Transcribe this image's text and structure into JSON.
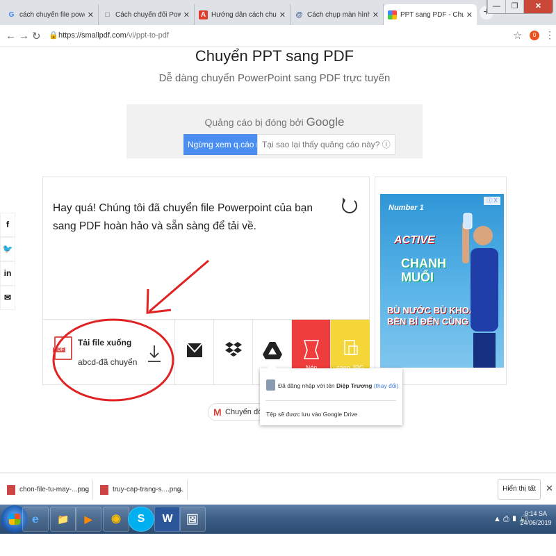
{
  "browser": {
    "tabs": [
      {
        "title": "cách chuyển file powerpoint sang",
        "icon": "G",
        "active": false
      },
      {
        "title": "Cách chuyển đổi PowerPoint sa",
        "icon": "□",
        "active": false
      },
      {
        "title": "Hướng dẫn cách chuyển đổi file",
        "icon": "A",
        "active": false
      },
      {
        "title": "Cách chụp màn hình máy tính n",
        "icon": "@",
        "active": false
      },
      {
        "title": "PPT sang PDF - Chuyển đổi Pow",
        "icon": "■",
        "active": true
      }
    ],
    "tab_close": "✕",
    "new_tab": "+",
    "url_host": "https://smallpdf.com",
    "url_path": "/vi/ppt-to-pdf",
    "profile_initial": "0"
  },
  "page": {
    "title": "Chuyển PPT sang PDF",
    "subtitle": "Dễ dàng chuyển PowerPoint sang PDF trực tuyến",
    "ad_top": {
      "closed_text": "Quảng cáo bị đóng bởi",
      "closed_brand": "Google",
      "stop_button": "Ngừng xem q.cáo này",
      "why_button": "Tại sao lại thấy quảng cáo này? ⓘ"
    },
    "social": [
      "f",
      "🐦",
      "in",
      "✉"
    ],
    "result": {
      "message": "Hay quá! Chúng tôi đã chuyển file Powerpoint của bạn sang PDF hoàn hảo và sẵn sàng để tải về.",
      "download_title": "Tải file xuống",
      "file_name": "abcd-đã chuyển",
      "pdf_label": "PDF",
      "compress_label": "Nén",
      "to_jpg_label": "sang JPG"
    },
    "side_ad": {
      "badge": "ⓘ X",
      "brand_line1": "Number 1",
      "brand_line2": "ACTIVE",
      "brand_line3": "CHANH\nMUỐI",
      "slogan": "BÙ NƯỚC BÙ KHOÁNG\nBỀN BỈ ĐẾN CÙNG"
    },
    "gmail_pill": "Chuyển đổi các",
    "drive_popup": {
      "logged_in_prefix": "Đã đăng nhập với tên",
      "user_name": "Diệp Trương",
      "change_link": "(thay đổi)",
      "save_note": "Tệp sẽ được lưu vào Google Drive"
    }
  },
  "downloads": {
    "items": [
      {
        "name": "chon-file-tu-may-...png"
      },
      {
        "name": "truy-cap-trang-s....png"
      }
    ],
    "show_all": "Hiển thị tất cả",
    "close": "✕"
  },
  "taskbar": {
    "clock_time": "9:14 SA",
    "clock_date": "24/06/2019",
    "apps": [
      "e",
      "📁",
      "▶",
      "◉",
      "S",
      "W",
      "🖼"
    ]
  },
  "colors": {
    "accent_blue": "#4a8ef0",
    "annotation_red": "#e02222",
    "compress_red": "#ef3d3d",
    "jpg_yellow": "#f4d638"
  }
}
